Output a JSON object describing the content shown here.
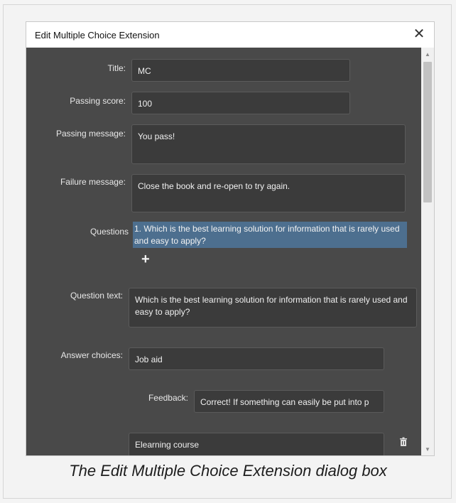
{
  "dialog": {
    "title": "Edit Multiple Choice Extension",
    "close_icon": "close-icon",
    "labels": {
      "title": "Title:",
      "passing_score": "Passing score:",
      "passing_message": "Passing message:",
      "failure_message": "Failure message:",
      "questions": "Questions",
      "question_text": "Question text:",
      "answer_choices": "Answer choices:",
      "feedback": "Feedback:"
    },
    "values": {
      "title": "MC",
      "passing_score": "100",
      "passing_message": "You pass!",
      "failure_message": "Close the book and re-open to try again.",
      "question_text": "Which is the best learning solution for information that is rarely used and easy to apply?",
      "answer_choice_1": "Job aid",
      "feedback_1": "Correct! If something can easily be put into p",
      "answer_choice_2": "Elearning course"
    },
    "questions_list": [
      "1. Which is the best learning solution for information that is rarely used and easy to apply?"
    ],
    "add_question_icon": "plus-icon",
    "delete_icon": "trash-icon"
  },
  "caption": "The Edit Multiple Choice Extension dialog box",
  "colors": {
    "panel_bg": "#494949",
    "field_bg": "#3b3b3b",
    "selection_bg": "#4d6f8f"
  }
}
